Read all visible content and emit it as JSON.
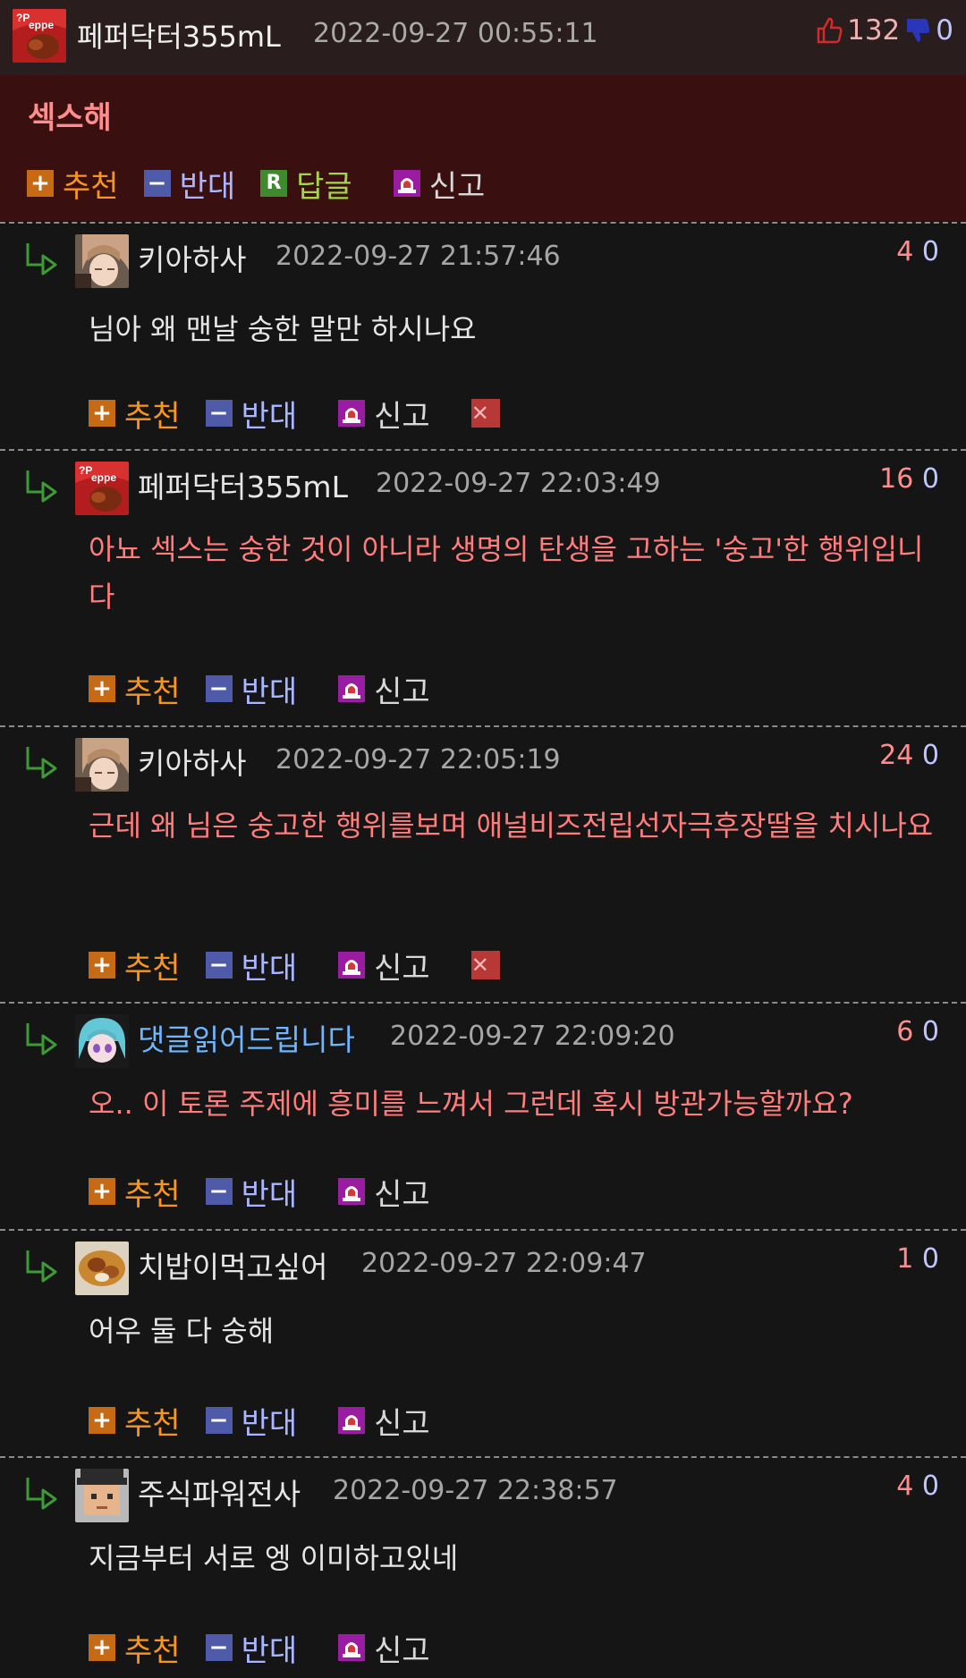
{
  "post": {
    "author": "페퍼닥터355mL",
    "date": "2022-09-27 00:55:11",
    "up_votes": "132",
    "down_votes": "0",
    "text": "섹스해",
    "actions": {
      "recommend": "추천",
      "oppose": "반대",
      "reply": "답글",
      "report": "신고",
      "reply_badge": "R"
    }
  },
  "comment_actions": {
    "recommend": "추천",
    "oppose": "반대",
    "report": "신고"
  },
  "comments": [
    {
      "author": "키아하사",
      "date": "2022-09-27 21:57:46",
      "up": "4",
      "down": "0",
      "text": "님아 왜 맨날 숭한 말만 하시나요",
      "avatar": "anime-face",
      "deletable": true
    },
    {
      "author": "페퍼닥터355mL",
      "date": "2022-09-27 22:03:49",
      "up": "16",
      "down": "0",
      "text": "아뇨 섹스는 숭한 것이 아니라 생명의 탄생을 고하는 '숭고'한 행위입니다",
      "avatar": "soda-can",
      "deletable": false
    },
    {
      "author": "키아하사",
      "date": "2022-09-27 22:05:19",
      "up": "24",
      "down": "0",
      "text": "근데 왜 님은 숭고한 행위를보며 애널비즈전립선자극후장딸을 치시나요",
      "avatar": "anime-face",
      "deletable": true
    },
    {
      "author": "댓글읽어드립니다",
      "date": "2022-09-27 22:09:20",
      "up": "6",
      "down": "0",
      "text": "오.. 이 토론 주제에 흥미를 느껴서 그런데 혹시 방관가능할까요?",
      "avatar": "anime-blue",
      "deletable": false
    },
    {
      "author": "치밥이먹고싶어",
      "date": "2022-09-27 22:09:47",
      "up": "1",
      "down": "0",
      "text": "어우 둘 다 숭해",
      "avatar": "food",
      "deletable": false
    },
    {
      "author": "주식파워전사",
      "date": "2022-09-27 22:38:57",
      "up": "4",
      "down": "0",
      "text": "지금부터 서로 엥 이미하고있네",
      "avatar": "pixel-face",
      "deletable": false
    }
  ],
  "colors": {
    "background": "#151515",
    "post_body": "#3a0f0f",
    "accent_red": "#ff7d7d",
    "recommend": "#f7961f",
    "oppose": "#aab6ff",
    "reply": "#a4d54a"
  },
  "icons": [
    "thumbs-up-icon",
    "thumbs-down-icon",
    "plus-icon",
    "minus-icon",
    "reply-icon",
    "report-siren-icon",
    "delete-x-icon",
    "reply-arrow-icon"
  ]
}
